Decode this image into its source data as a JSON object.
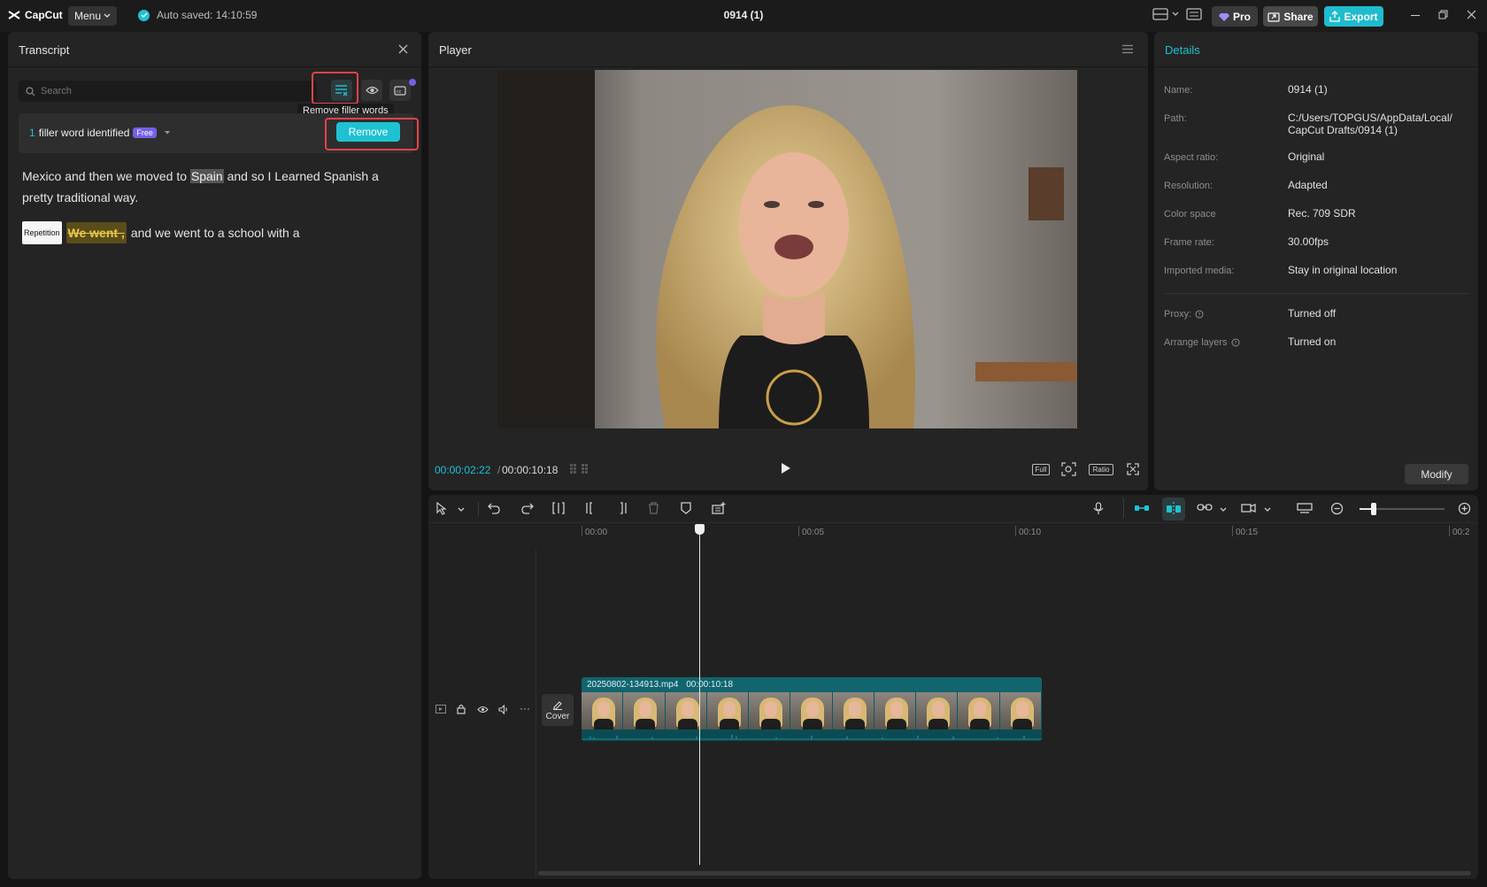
{
  "app": {
    "logo_text": "CapCut",
    "menu_label": "Menu",
    "autosave_text": "Auto saved: 14:10:59",
    "document_title": "0914 (1)",
    "pro_label": "Pro",
    "share_label": "Share",
    "export_label": "Export"
  },
  "transcript": {
    "title": "Transcript",
    "search_placeholder": "Search",
    "tooltip": "Remove filler words",
    "filler_count": "1",
    "filler_text": "filler word identified",
    "free_badge": "Free",
    "remove_label": "Remove",
    "para1_before": "Mexico and then we moved to ",
    "para1_highlight": "Spain",
    "para1_after": " and so I Learned Spanish a pretty traditional way.",
    "repetition_badge": "Repetition",
    "repetition_words": "We went ,",
    "para2_after": "and we went to a school with a"
  },
  "player": {
    "title": "Player",
    "current_time": "00:00:02:22",
    "separator": "/",
    "total_time": "00:00:10:18",
    "full_label": "Full",
    "ratio_label": "Ratio"
  },
  "details": {
    "title": "Details",
    "rows": [
      {
        "label": "Name:",
        "value": "0914 (1)"
      },
      {
        "label": "Path:",
        "value": "C:/Users/TOPGUS/AppData/Local/ CapCut Drafts/0914 (1)"
      },
      {
        "label": "Aspect ratio:",
        "value": "Original"
      },
      {
        "label": "Resolution:",
        "value": "Adapted"
      },
      {
        "label": "Color space",
        "value": "Rec. 709 SDR"
      },
      {
        "label": "Frame rate:",
        "value": "30.00fps"
      },
      {
        "label": "Imported media:",
        "value": "Stay in original location"
      },
      {
        "label": "Proxy:",
        "value": "Turned off"
      },
      {
        "label": "Arrange layers",
        "value": "Turned on"
      }
    ],
    "modify_label": "Modify"
  },
  "timeline": {
    "ruler": [
      "00:00",
      "00:05",
      "00:10",
      "00:15",
      "00:2"
    ],
    "clip_name": "20250802-134913.mp4",
    "clip_duration": "00:00:10:18",
    "cover_label": "Cover",
    "zoom_level": 0.08
  },
  "colors": {
    "accent": "#1fc2d2",
    "highlight_box": "#e8434b",
    "free_badge": "#7360e8"
  }
}
